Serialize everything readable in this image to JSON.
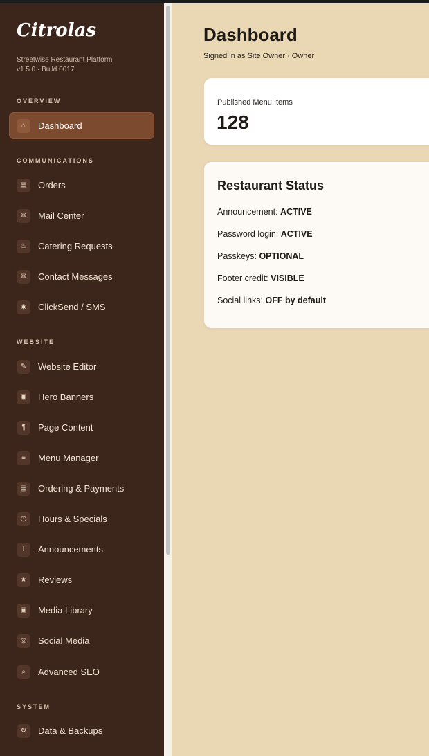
{
  "brand": {
    "name": "Citrolas",
    "tagline": "Streetwise Restaurant Platform",
    "version": "v1.5.0 · Build 0017"
  },
  "sidebar": {
    "sections": [
      {
        "title": "OVERVIEW"
      },
      {
        "title": "COMMUNICATIONS"
      },
      {
        "title": "WEBSITE"
      },
      {
        "title": "SYSTEM"
      }
    ],
    "items": [
      {
        "label": "Dashboard",
        "icon": "home-icon",
        "glyph": "⌂",
        "active": true
      },
      {
        "label": "Orders",
        "icon": "orders-icon",
        "glyph": "▤"
      },
      {
        "label": "Mail Center",
        "icon": "mail-icon",
        "glyph": "✉"
      },
      {
        "label": "Catering Requests",
        "icon": "catering-icon",
        "glyph": "♨"
      },
      {
        "label": "Contact Messages",
        "icon": "message-icon",
        "glyph": "✉"
      },
      {
        "label": "ClickSend / SMS",
        "icon": "sms-icon",
        "glyph": "◉"
      },
      {
        "label": "Website Editor",
        "icon": "pencil-icon",
        "glyph": "✎"
      },
      {
        "label": "Hero Banners",
        "icon": "banner-icon",
        "glyph": "▣"
      },
      {
        "label": "Page Content",
        "icon": "paragraph-icon",
        "glyph": "¶"
      },
      {
        "label": "Menu Manager",
        "icon": "menu-list-icon",
        "glyph": "≡"
      },
      {
        "label": "Ordering & Payments",
        "icon": "payments-icon",
        "glyph": "▤"
      },
      {
        "label": "Hours & Specials",
        "icon": "clock-icon",
        "glyph": "◷"
      },
      {
        "label": "Announcements",
        "icon": "announcement-icon",
        "glyph": "!"
      },
      {
        "label": "Reviews",
        "icon": "star-icon",
        "glyph": "★"
      },
      {
        "label": "Media Library",
        "icon": "media-icon",
        "glyph": "▣"
      },
      {
        "label": "Social Media",
        "icon": "social-icon",
        "glyph": "◎"
      },
      {
        "label": "Advanced SEO",
        "icon": "search-icon",
        "glyph": "⌕"
      },
      {
        "label": "Data & Backups",
        "icon": "backup-icon",
        "glyph": "↻"
      }
    ]
  },
  "main": {
    "title": "Dashboard",
    "signed_in": "Signed in as Site Owner · Owner",
    "stat": {
      "label": "Published Menu Items",
      "value": "128"
    },
    "status": {
      "title": "Restaurant Status",
      "rows": [
        {
          "label": "Announcement:",
          "value": "ACTIVE"
        },
        {
          "label": "Password login:",
          "value": "ACTIVE"
        },
        {
          "label": "Passkeys:",
          "value": "OPTIONAL"
        },
        {
          "label": "Footer credit:",
          "value": "VISIBLE"
        },
        {
          "label": "Social links:",
          "value": "OFF by default"
        }
      ]
    }
  },
  "colors": {
    "sidebar_bg": "#3c261b",
    "active_item": "#7b4a2f",
    "page_bg": "#ead7b4",
    "card_bg": "#ffffff"
  }
}
